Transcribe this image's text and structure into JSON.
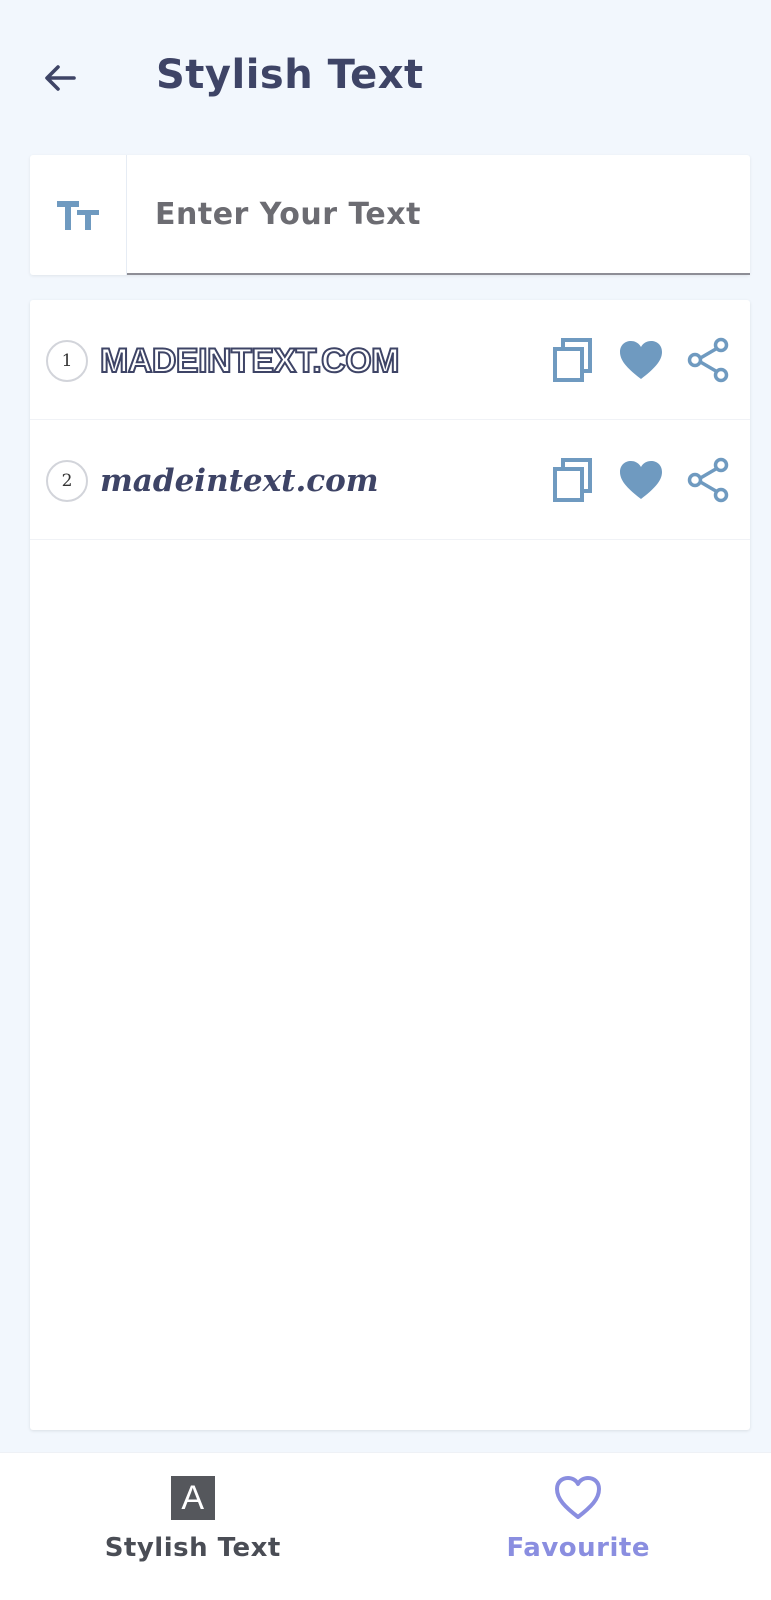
{
  "header": {
    "title": "Stylish Text",
    "back_icon": "arrow-left-icon"
  },
  "input": {
    "icon": "text-size-icon",
    "icon_text": "TT",
    "placeholder": "Enter Your Text",
    "value": ""
  },
  "results": [
    {
      "number": "1",
      "text": "MADEINTEXT.COM",
      "style": "outline-caps"
    },
    {
      "number": "2",
      "text": "madeintext.com",
      "style": "bold-italic-serif"
    }
  ],
  "actions": {
    "copy_icon": "copy-icon",
    "favourite_icon": "heart-icon",
    "share_icon": "share-icon"
  },
  "bottom_nav": {
    "items": [
      {
        "label": "Stylish Text",
        "icon": "letter-a-icon",
        "icon_text": "A",
        "active": false
      },
      {
        "label": "Favourite",
        "icon": "heart-outline-icon",
        "active": true
      }
    ]
  },
  "colors": {
    "background": "#f2f7fd",
    "title": "#3e4466",
    "accent_icon": "#6f9ac0",
    "nav_active": "#8a8ee0",
    "nav_inactive": "#4a4d55"
  }
}
